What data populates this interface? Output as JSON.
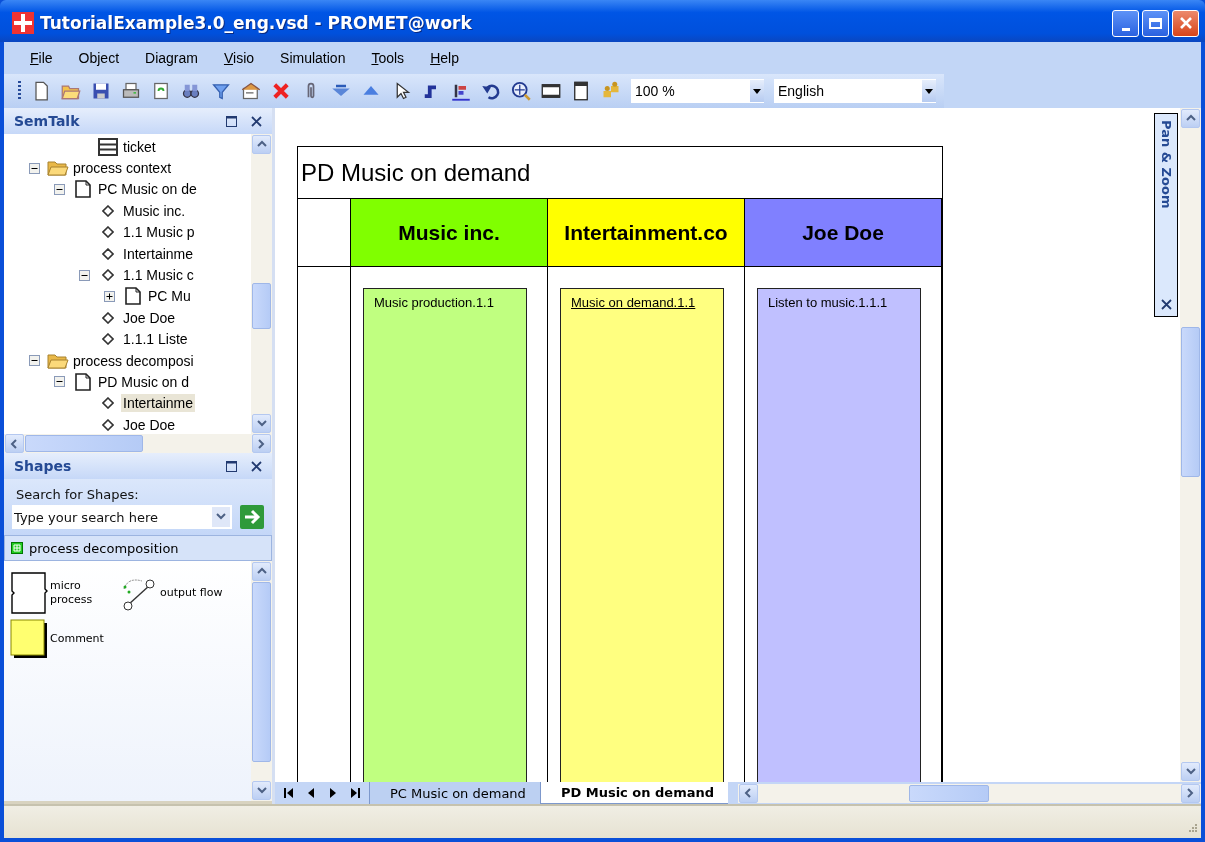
{
  "window": {
    "title": "TutorialExample3.0_eng.vsd - PROMET@work"
  },
  "menu": [
    {
      "label": "File",
      "mnemonic": true
    },
    {
      "label": "Object",
      "mnemonic": false
    },
    {
      "label": "Diagram",
      "mnemonic": false
    },
    {
      "label": "Visio",
      "mnemonic": true
    },
    {
      "label": "Simulation",
      "mnemonic": false
    },
    {
      "label": "Tools",
      "mnemonic": true
    },
    {
      "label": "Help",
      "mnemonic": true
    }
  ],
  "toolbar": {
    "zoom": "100 %",
    "language": "English"
  },
  "semtalk": {
    "title": "SemTalk",
    "tree": [
      {
        "children": [
          {
            "children": [
              {
                "label": "ticket",
                "kind": "table",
                "selected": false
              }
            ]
          }
        ]
      },
      {
        "label": "process context",
        "kind": "folder",
        "expanded": true,
        "selected": false,
        "children": [
          {
            "label": "PC Music on de",
            "kind": "page",
            "expanded": true,
            "selected": false,
            "children": [
              {
                "label": "Music inc.",
                "kind": "instance",
                "selected": false
              },
              {
                "label": "1.1 Music p",
                "kind": "instance",
                "selected": false
              },
              {
                "label": "Intertainme",
                "kind": "instance",
                "selected": false
              },
              {
                "label": "1.1 Music c",
                "kind": "instance",
                "expanded": true,
                "selected": false,
                "children": [
                  {
                    "label": "PC Mu",
                    "kind": "page",
                    "expanded": false,
                    "selected": false
                  }
                ]
              },
              {
                "label": "Joe Doe",
                "kind": "instance",
                "selected": false
              },
              {
                "label": "1.1.1 Liste",
                "kind": "instance",
                "selected": false
              }
            ]
          }
        ]
      },
      {
        "label": "process decomposi",
        "kind": "folder",
        "expanded": true,
        "selected": false,
        "children": [
          {
            "label": "PD Music on d",
            "kind": "page",
            "expanded": true,
            "selected": false,
            "children": [
              {
                "label": "Intertainme",
                "kind": "instance",
                "selected": true
              },
              {
                "label": "Joe Doe",
                "kind": "instance",
                "selected": false
              }
            ]
          }
        ]
      }
    ]
  },
  "shapes": {
    "title": "Shapes",
    "search_label": "Search for Shapes:",
    "search": {
      "placeholder": "Type your search here"
    },
    "stencil": "process decomposition",
    "items": [
      {
        "label": "micro process",
        "kind": "micro-process"
      },
      {
        "label": "output flow",
        "kind": "flow"
      },
      {
        "label": "Comment",
        "kind": "comment"
      }
    ]
  },
  "diagram": {
    "title": "PD Music on demand",
    "lanes": [
      {
        "name": "Music inc.",
        "color": "#80ff00",
        "process": {
          "label": "Music production.1.1",
          "color": "#c0ff80",
          "linked": false
        }
      },
      {
        "name": "Intertainment.co",
        "color": "#ffff00",
        "process": {
          "label": "Music on demand.1.1",
          "color": "#ffff80",
          "linked": true
        }
      },
      {
        "name": "Joe Doe",
        "color": "#8080ff",
        "process": {
          "label": "Listen to music.1.1.1",
          "color": "#c0c0ff",
          "linked": false
        }
      }
    ]
  },
  "pan_zoom": {
    "title": "Pan & Zoom"
  },
  "page_tabs": [
    {
      "label": "PC Music on demand",
      "selected": false
    },
    {
      "label": "PD Music on demand",
      "selected": true
    }
  ]
}
